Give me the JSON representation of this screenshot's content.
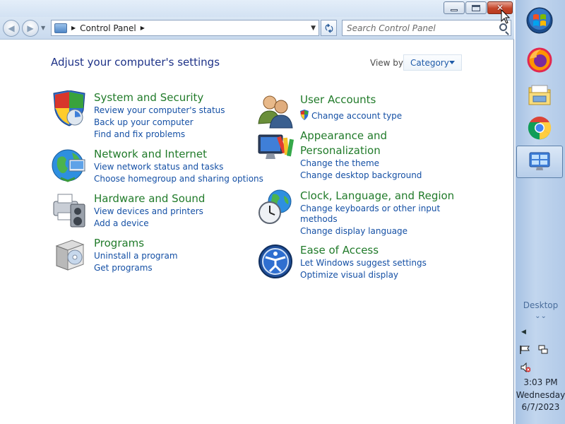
{
  "window": {
    "close_color": "#c4472b",
    "accent": "#1550a5"
  },
  "navbar": {
    "breadcrumb": "Control Panel",
    "search_placeholder": "Search Control Panel"
  },
  "main": {
    "heading": "Adjust your computer's settings",
    "view_by_label": "View by:",
    "view_by_value": "Category",
    "left_categories": [
      {
        "title": "System and Security",
        "icon": "shield-icon",
        "links": [
          "Review your computer's status",
          "Back up your computer",
          "Find and fix problems"
        ]
      },
      {
        "title": "Network and Internet",
        "icon": "network-globe-icon",
        "links": [
          "View network status and tasks",
          "Choose homegroup and sharing options"
        ]
      },
      {
        "title": "Hardware and Sound",
        "icon": "printer-speaker-icon",
        "links": [
          "View devices and printers",
          "Add a device"
        ]
      },
      {
        "title": "Programs",
        "icon": "programs-box-icon",
        "links": [
          "Uninstall a program",
          "Get programs"
        ]
      }
    ],
    "right_categories": [
      {
        "title": "User Accounts",
        "icon": "users-icon",
        "links": [
          "Change account type"
        ]
      },
      {
        "title_line1": "Appearance and",
        "title_line2": "Personalization",
        "icon": "monitor-palette-icon",
        "links": [
          "Change the theme",
          "Change desktop background"
        ]
      },
      {
        "title": "Clock, Language, and Region",
        "icon": "clock-globe-icon",
        "links_line1": "Change keyboards or other input",
        "links_line2": "methods",
        "links": [
          "Change display language"
        ]
      },
      {
        "title": "Ease of Access",
        "icon": "ease-of-access-icon",
        "links": [
          "Let Windows suggest settings",
          "Optimize visual display"
        ]
      }
    ]
  },
  "taskbar": {
    "items": [
      "start-orb-icon",
      "firefox-icon",
      "explorer-folder-icon",
      "chrome-icon",
      "control-panel-icon"
    ],
    "desktop_label": "Desktop",
    "time": "3:03 PM",
    "day": "Wednesday",
    "date": "6/7/2023"
  }
}
